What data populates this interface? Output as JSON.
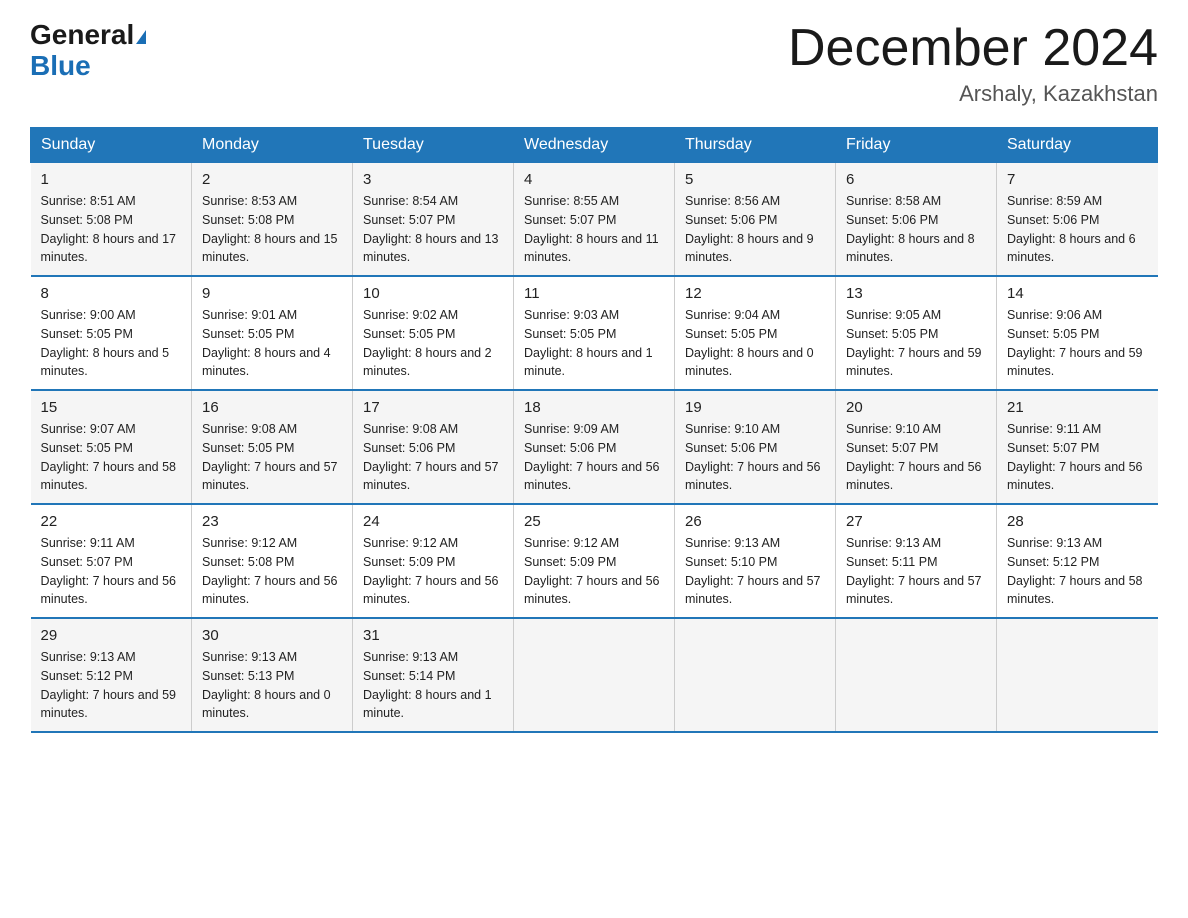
{
  "header": {
    "logo_general": "General",
    "logo_blue": "Blue",
    "month_title": "December 2024",
    "location": "Arshaly, Kazakhstan"
  },
  "weekdays": [
    "Sunday",
    "Monday",
    "Tuesday",
    "Wednesday",
    "Thursday",
    "Friday",
    "Saturday"
  ],
  "weeks": [
    [
      {
        "day": "1",
        "sunrise": "8:51 AM",
        "sunset": "5:08 PM",
        "daylight": "8 hours and 17 minutes."
      },
      {
        "day": "2",
        "sunrise": "8:53 AM",
        "sunset": "5:08 PM",
        "daylight": "8 hours and 15 minutes."
      },
      {
        "day": "3",
        "sunrise": "8:54 AM",
        "sunset": "5:07 PM",
        "daylight": "8 hours and 13 minutes."
      },
      {
        "day": "4",
        "sunrise": "8:55 AM",
        "sunset": "5:07 PM",
        "daylight": "8 hours and 11 minutes."
      },
      {
        "day": "5",
        "sunrise": "8:56 AM",
        "sunset": "5:06 PM",
        "daylight": "8 hours and 9 minutes."
      },
      {
        "day": "6",
        "sunrise": "8:58 AM",
        "sunset": "5:06 PM",
        "daylight": "8 hours and 8 minutes."
      },
      {
        "day": "7",
        "sunrise": "8:59 AM",
        "sunset": "5:06 PM",
        "daylight": "8 hours and 6 minutes."
      }
    ],
    [
      {
        "day": "8",
        "sunrise": "9:00 AM",
        "sunset": "5:05 PM",
        "daylight": "8 hours and 5 minutes."
      },
      {
        "day": "9",
        "sunrise": "9:01 AM",
        "sunset": "5:05 PM",
        "daylight": "8 hours and 4 minutes."
      },
      {
        "day": "10",
        "sunrise": "9:02 AM",
        "sunset": "5:05 PM",
        "daylight": "8 hours and 2 minutes."
      },
      {
        "day": "11",
        "sunrise": "9:03 AM",
        "sunset": "5:05 PM",
        "daylight": "8 hours and 1 minute."
      },
      {
        "day": "12",
        "sunrise": "9:04 AM",
        "sunset": "5:05 PM",
        "daylight": "8 hours and 0 minutes."
      },
      {
        "day": "13",
        "sunrise": "9:05 AM",
        "sunset": "5:05 PM",
        "daylight": "7 hours and 59 minutes."
      },
      {
        "day": "14",
        "sunrise": "9:06 AM",
        "sunset": "5:05 PM",
        "daylight": "7 hours and 59 minutes."
      }
    ],
    [
      {
        "day": "15",
        "sunrise": "9:07 AM",
        "sunset": "5:05 PM",
        "daylight": "7 hours and 58 minutes."
      },
      {
        "day": "16",
        "sunrise": "9:08 AM",
        "sunset": "5:05 PM",
        "daylight": "7 hours and 57 minutes."
      },
      {
        "day": "17",
        "sunrise": "9:08 AM",
        "sunset": "5:06 PM",
        "daylight": "7 hours and 57 minutes."
      },
      {
        "day": "18",
        "sunrise": "9:09 AM",
        "sunset": "5:06 PM",
        "daylight": "7 hours and 56 minutes."
      },
      {
        "day": "19",
        "sunrise": "9:10 AM",
        "sunset": "5:06 PM",
        "daylight": "7 hours and 56 minutes."
      },
      {
        "day": "20",
        "sunrise": "9:10 AM",
        "sunset": "5:07 PM",
        "daylight": "7 hours and 56 minutes."
      },
      {
        "day": "21",
        "sunrise": "9:11 AM",
        "sunset": "5:07 PM",
        "daylight": "7 hours and 56 minutes."
      }
    ],
    [
      {
        "day": "22",
        "sunrise": "9:11 AM",
        "sunset": "5:07 PM",
        "daylight": "7 hours and 56 minutes."
      },
      {
        "day": "23",
        "sunrise": "9:12 AM",
        "sunset": "5:08 PM",
        "daylight": "7 hours and 56 minutes."
      },
      {
        "day": "24",
        "sunrise": "9:12 AM",
        "sunset": "5:09 PM",
        "daylight": "7 hours and 56 minutes."
      },
      {
        "day": "25",
        "sunrise": "9:12 AM",
        "sunset": "5:09 PM",
        "daylight": "7 hours and 56 minutes."
      },
      {
        "day": "26",
        "sunrise": "9:13 AM",
        "sunset": "5:10 PM",
        "daylight": "7 hours and 57 minutes."
      },
      {
        "day": "27",
        "sunrise": "9:13 AM",
        "sunset": "5:11 PM",
        "daylight": "7 hours and 57 minutes."
      },
      {
        "day": "28",
        "sunrise": "9:13 AM",
        "sunset": "5:12 PM",
        "daylight": "7 hours and 58 minutes."
      }
    ],
    [
      {
        "day": "29",
        "sunrise": "9:13 AM",
        "sunset": "5:12 PM",
        "daylight": "7 hours and 59 minutes."
      },
      {
        "day": "30",
        "sunrise": "9:13 AM",
        "sunset": "5:13 PM",
        "daylight": "8 hours and 0 minutes."
      },
      {
        "day": "31",
        "sunrise": "9:13 AM",
        "sunset": "5:14 PM",
        "daylight": "8 hours and 1 minute."
      },
      null,
      null,
      null,
      null
    ]
  ],
  "labels": {
    "sunrise": "Sunrise:",
    "sunset": "Sunset:",
    "daylight": "Daylight:"
  }
}
